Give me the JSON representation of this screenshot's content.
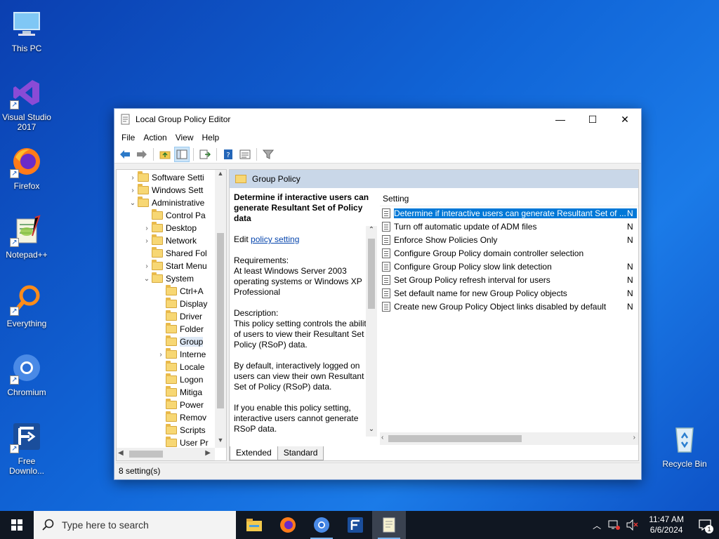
{
  "desktop": {
    "icons": [
      {
        "label": "This PC"
      },
      {
        "label": "Visual Studio 2017"
      },
      {
        "label": "Firefox"
      },
      {
        "label": "Notepad++"
      },
      {
        "label": "Everything"
      },
      {
        "label": "Chromium"
      },
      {
        "label": "Free Downlo..."
      },
      {
        "label": "Recycle Bin"
      }
    ]
  },
  "window": {
    "title": "Local Group Policy Editor",
    "minimize": "—",
    "maximize": "☐",
    "close": "✕",
    "menu": [
      "File",
      "Action",
      "View",
      "Help"
    ]
  },
  "tree": {
    "items": [
      {
        "label": "Software Setti",
        "chevron": "›"
      },
      {
        "label": "Windows Sett",
        "chevron": "›"
      },
      {
        "label": "Administrative",
        "chevron": "⌄"
      },
      {
        "label": "Control Pa",
        "chevron": ""
      },
      {
        "label": "Desktop",
        "chevron": "›"
      },
      {
        "label": "Network",
        "chevron": "›"
      },
      {
        "label": "Shared Fol",
        "chevron": ""
      },
      {
        "label": "Start Menu",
        "chevron": "›"
      },
      {
        "label": "System",
        "chevron": "⌄"
      },
      {
        "label": "Ctrl+A",
        "chevron": ""
      },
      {
        "label": "Display",
        "chevron": ""
      },
      {
        "label": "Driver",
        "chevron": ""
      },
      {
        "label": "Folder",
        "chevron": ""
      },
      {
        "label": "Group",
        "chevron": ""
      },
      {
        "label": "Interne",
        "chevron": "›"
      },
      {
        "label": "Locale",
        "chevron": ""
      },
      {
        "label": "Logon",
        "chevron": ""
      },
      {
        "label": "Mitiga",
        "chevron": ""
      },
      {
        "label": "Power",
        "chevron": ""
      },
      {
        "label": "Remov",
        "chevron": ""
      },
      {
        "label": "Scripts",
        "chevron": ""
      },
      {
        "label": "User Pr",
        "chevron": ""
      }
    ]
  },
  "right_pane": {
    "header": "Group Policy",
    "description": {
      "title": "Determine if interactive users can generate Resultant Set of Policy data",
      "edit_prefix": "Edit ",
      "edit_link": "policy setting",
      "requirements_label": "Requirements:",
      "requirements": "At least Windows Server 2003 operating systems or Windows XP Professional",
      "description_label": "Description:",
      "paragraph1": "This policy setting controls the ability of users to view their Resultant Set of Policy (RSoP) data.",
      "paragraph2": "By default, interactively logged on users can view their own Resultant Set of Policy (RSoP) data.",
      "paragraph3": "If you enable this policy setting, interactive users cannot generate RSoP data."
    },
    "column_header": "Setting",
    "settings": [
      {
        "name": "Determine if interactive users can generate Resultant Set of ...",
        "state": "N"
      },
      {
        "name": "Turn off automatic update of ADM files",
        "state": "N"
      },
      {
        "name": "Enforce Show Policies Only",
        "state": "N"
      },
      {
        "name": "Configure Group Policy domain controller selection",
        "state": ""
      },
      {
        "name": "Configure Group Policy slow link detection",
        "state": "N"
      },
      {
        "name": "Set Group Policy refresh interval for users",
        "state": "N"
      },
      {
        "name": "Set default name for new Group Policy objects",
        "state": "N"
      },
      {
        "name": "Create new Group Policy Object links disabled by default",
        "state": "N"
      }
    ],
    "tabs": [
      "Extended",
      "Standard"
    ]
  },
  "statusbar": {
    "text": "8 setting(s)"
  },
  "taskbar": {
    "search_placeholder": "Type here to search",
    "time": "11:47 AM",
    "date": "6/6/2024",
    "notification_count": "1"
  }
}
